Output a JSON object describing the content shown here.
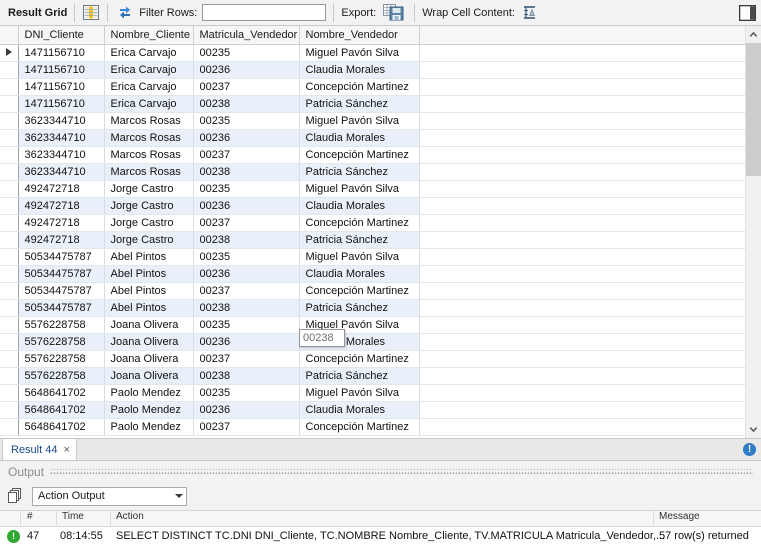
{
  "toolbar": {
    "title": "Result Grid",
    "grid_icon": "grid-view-icon",
    "refresh_icon": "refresh-icon",
    "filter_label": "Filter Rows:",
    "filter_value": "",
    "filter_placeholder": "",
    "export_label": "Export:",
    "export_icon": "export-save-icon",
    "wrap_label": "Wrap Cell Content:",
    "wrap_icon": "wrap-cell-content-icon",
    "panel_toggle_icon": "toggle-side-panel-icon"
  },
  "grid": {
    "columns": [
      "DNI_Cliente",
      "Nombre_Cliente",
      "Matricula_Vendedor",
      "Nombre_Vendedor"
    ],
    "current_row_marker": "▶",
    "rows": [
      [
        "1471156710",
        "Erica Carvajo",
        "00235",
        "Miguel Pavón Silva"
      ],
      [
        "1471156710",
        "Erica Carvajo",
        "00236",
        "Claudia Morales"
      ],
      [
        "1471156710",
        "Erica Carvajo",
        "00237",
        "Concepción Martinez"
      ],
      [
        "1471156710",
        "Erica Carvajo",
        "00238",
        "Patricia Sánchez"
      ],
      [
        "3623344710",
        "Marcos Rosas",
        "00235",
        "Miguel Pavón Silva"
      ],
      [
        "3623344710",
        "Marcos Rosas",
        "00236",
        "Claudia Morales"
      ],
      [
        "3623344710",
        "Marcos Rosas",
        "00237",
        "Concepción Martinez"
      ],
      [
        "3623344710",
        "Marcos Rosas",
        "00238",
        "Patricia Sánchez"
      ],
      [
        "492472718",
        "Jorge Castro",
        "00235",
        "Miguel Pavón Silva"
      ],
      [
        "492472718",
        "Jorge Castro",
        "00236",
        "Claudia Morales"
      ],
      [
        "492472718",
        "Jorge Castro",
        "00237",
        "Concepción Martinez"
      ],
      [
        "492472718",
        "Jorge Castro",
        "00238",
        "Patricia Sánchez"
      ],
      [
        "50534475787",
        "Abel Pintos",
        "00235",
        "Miguel Pavón Silva"
      ],
      [
        "50534475787",
        "Abel Pintos",
        "00236",
        "Claudia Morales"
      ],
      [
        "50534475787",
        "Abel Pintos",
        "00237",
        "Concepción Martinez"
      ],
      [
        "50534475787",
        "Abel Pintos",
        "00238",
        "Patricia Sánchez"
      ],
      [
        "5576228758",
        "Joana Olivera",
        "00235",
        "Miguel Pavón Silva"
      ],
      [
        "5576228758",
        "Joana Olivera",
        "00236",
        "Claudia Morales"
      ],
      [
        "5576228758",
        "Joana Olivera",
        "00237",
        "Concepción Martinez"
      ],
      [
        "5576228758",
        "Joana Olivera",
        "00238",
        "Patricia Sánchez"
      ],
      [
        "5648641702",
        "Paolo Mendez",
        "00235",
        "Miguel Pavón Silva"
      ],
      [
        "5648641702",
        "Paolo Mendez",
        "00236",
        "Claudia Morales"
      ],
      [
        "5648641702",
        "Paolo Mendez",
        "00237",
        "Concepción Martinez"
      ]
    ],
    "edit_cell_value": "00238"
  },
  "result_tabs": {
    "label": "Result 44",
    "close": "×",
    "info_badge": "!"
  },
  "output": {
    "section_title": "Output",
    "mode_selected": "Action Output",
    "mode_icon": "action-output-icon",
    "columns": [
      "#",
      "Time",
      "Action",
      "Message"
    ],
    "entries": [
      {
        "status": "success",
        "num": "47",
        "time": "08:14:55",
        "action": "SELECT DISTINCT TC.DNI DNI_Cliente, TC.NOMBRE Nombre_Cliente, TV.MATRICULA Matricula_Vendedor,...",
        "message": "57 row(s) returned"
      }
    ]
  },
  "colors": {
    "alt_row": "#eaf0fa",
    "toolbar_bg": "#f2f2f2",
    "tab_link": "#1a4a8a",
    "success": "#2fa82f",
    "info": "#2f7bc4"
  }
}
